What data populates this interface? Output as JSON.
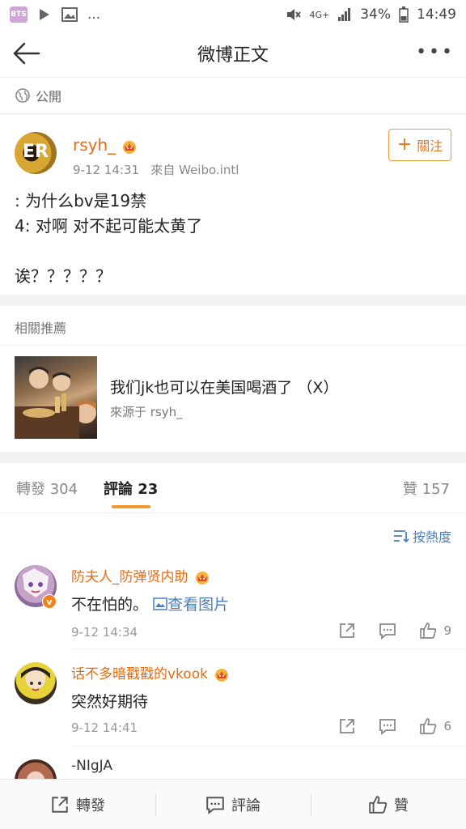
{
  "status_bar": {
    "dots": "...",
    "network": "4G+",
    "battery": "34%",
    "time": "14:49",
    "app_badge": "BTS"
  },
  "nav": {
    "title": "微博正文"
  },
  "visibility": {
    "label": "公開"
  },
  "post": {
    "username": "rsyh_",
    "time": "9-12 14:31",
    "source": "來自 Weibo.intl",
    "follow_label": "關注",
    "text": ": 为什么bv是19禁\n4: 对啊 对不起可能太黄了\n\n诶？？？？？"
  },
  "related": {
    "heading": "相關推薦",
    "item_title": "我们jk也可以在美国喝酒了 （X）",
    "item_source": "來源于 rsyh_"
  },
  "tabs": {
    "repost": "轉發 304",
    "comments": "評論 23",
    "likes": "贊 157"
  },
  "sort_label": "按熱度",
  "comments": [
    {
      "name": "防夫人_防弹贤内助",
      "text": "不在怕的。",
      "link": "查看图片",
      "time": "9-12 14:34",
      "likes": "9"
    },
    {
      "name": "话不多暗戳戳的vkook",
      "text": "突然好期待",
      "time": "9-12 14:41",
      "likes": "6"
    },
    {
      "name": "-NIgJA"
    }
  ],
  "bottom_bar": {
    "repost": "轉發",
    "comment": "評論",
    "like": "贊"
  },
  "colors": {
    "accent_orange": "#e86b0f",
    "link_blue": "#4a7fc0",
    "tab_underline": "#f09a2e"
  }
}
